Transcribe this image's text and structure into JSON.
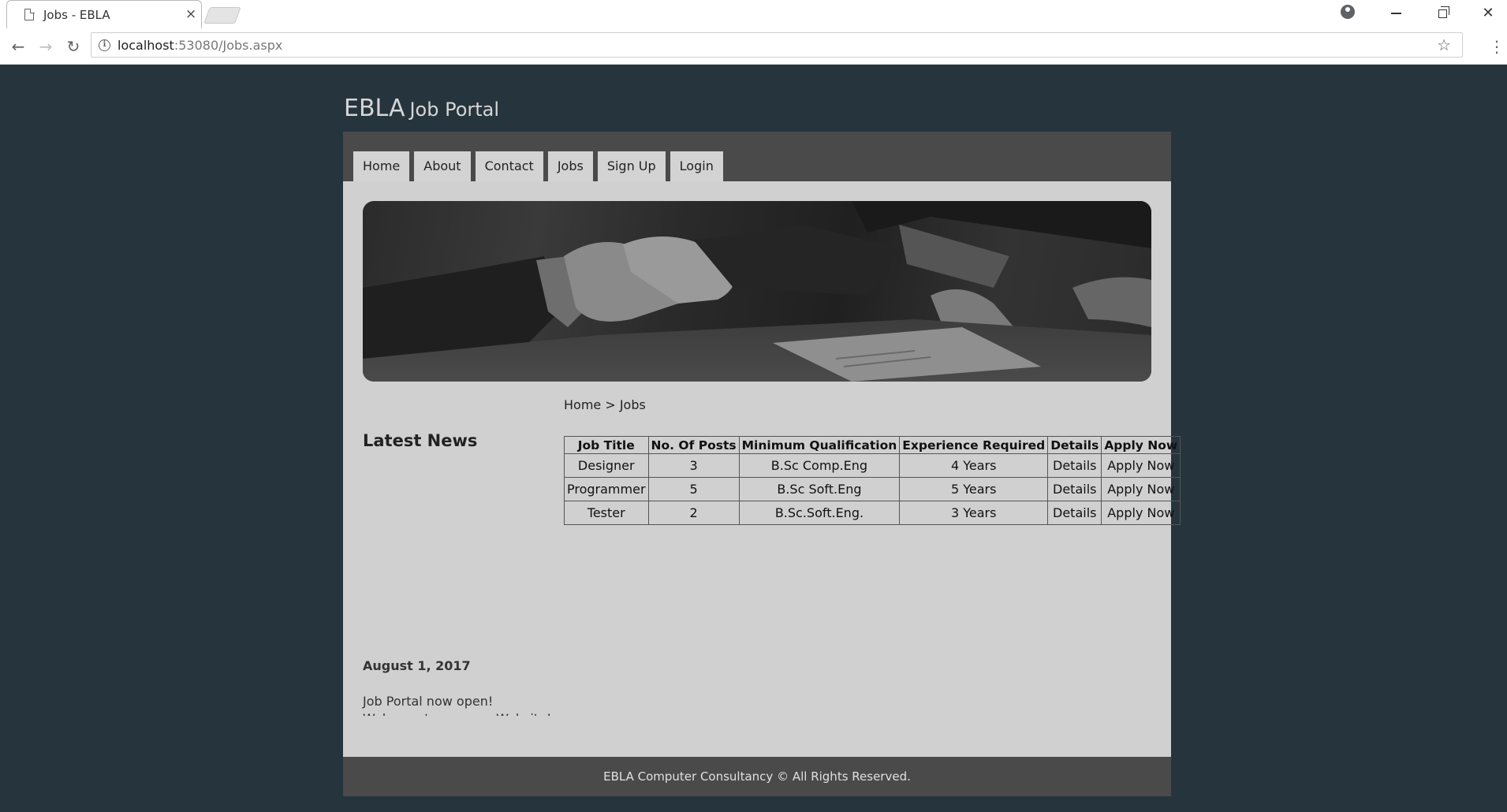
{
  "browser": {
    "tab_title": "Jobs - EBLA",
    "tab_close": "×",
    "url_host": "localhost",
    "url_rest": ":53080/Jobs.aspx"
  },
  "site": {
    "brand": "EBLA",
    "subtitle": "Job Portal"
  },
  "nav": {
    "items": [
      "Home",
      "About",
      "Contact",
      "Jobs",
      "Sign Up",
      "Login"
    ]
  },
  "breadcrumb": "Home > Jobs",
  "news": {
    "title": "Latest News",
    "date": "August 1, 2017",
    "line1": "Job Portal now open!",
    "line2": "Welcome to our new Website!"
  },
  "jobs_table": {
    "headers": [
      "Job Title",
      "No. Of Posts",
      "Minimum Qualification",
      "Experience Required",
      "Details",
      "Apply Now"
    ],
    "rows": [
      [
        "Designer",
        "3",
        "B.Sc Comp.Eng",
        "4 Years",
        "Details",
        "Apply Now"
      ],
      [
        "Programmer",
        "5",
        "B.Sc Soft.Eng",
        "5 Years",
        "Details",
        "Apply Now"
      ],
      [
        "Tester",
        "2",
        "B.Sc.Soft.Eng.",
        "3 Years",
        "Details",
        "Apply Now"
      ]
    ]
  },
  "footer": "EBLA Computer Consultancy © All Rights Reserved.",
  "colors": {
    "page_bg": "#26343d",
    "content_bg": "#d0d0d0",
    "navbar_bg": "#4a4a4a",
    "menu_item_bg": "#d3d3d3"
  }
}
